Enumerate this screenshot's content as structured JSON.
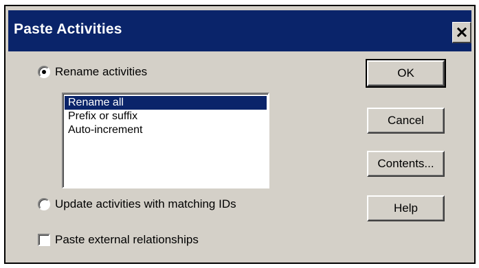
{
  "dialog": {
    "title": "Paste Activities",
    "close_icon": "close-icon"
  },
  "options": {
    "rename_label": "Rename activities",
    "rename_selected": true,
    "update_label": "Update activities with matching IDs",
    "update_selected": false,
    "external_label": "Paste external relationships",
    "external_checked": false
  },
  "rename_list": {
    "items": [
      "Rename all",
      "Prefix or suffix",
      "Auto-increment"
    ],
    "selected": "Rename all"
  },
  "buttons": {
    "ok": "OK",
    "cancel": "Cancel",
    "contents": "Contents...",
    "help": "Help"
  },
  "colors": {
    "titlebar": "#0a246a",
    "face": "#d4d0c8",
    "selection": "#0a246a"
  }
}
